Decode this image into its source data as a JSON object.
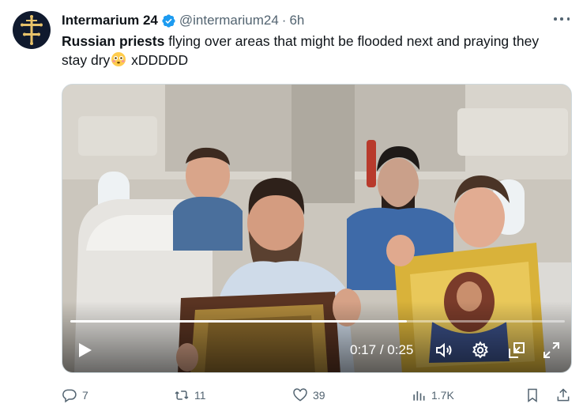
{
  "author": {
    "display_name": "Intermarium 24",
    "handle": "@intermarium24",
    "separator": "·",
    "time": "6h",
    "verified": true,
    "avatar_icon": "orthodox-cross-icon"
  },
  "tweet": {
    "text_bold": "Russian priests",
    "text_rest_1": " flying over areas that might be flooded next and praying they stay dry",
    "emoji": "flushed-face-emoji",
    "text_rest_2": " xDDDDD"
  },
  "media": {
    "type": "video",
    "current_time": "0:17",
    "time_separator": " / ",
    "duration": "0:25",
    "progress": 0.68,
    "controls": [
      "play-icon",
      "volume-icon",
      "settings-gear-icon",
      "picture-in-picture-icon",
      "fullscreen-icon"
    ]
  },
  "stats": {
    "replies": "7",
    "reposts": "11",
    "likes": "39",
    "views": "1.7K"
  },
  "colors": {
    "text_primary": "#0f1419",
    "text_secondary": "#536471",
    "verified_blue": "#1d9bf0",
    "border": "#cfd9de"
  }
}
